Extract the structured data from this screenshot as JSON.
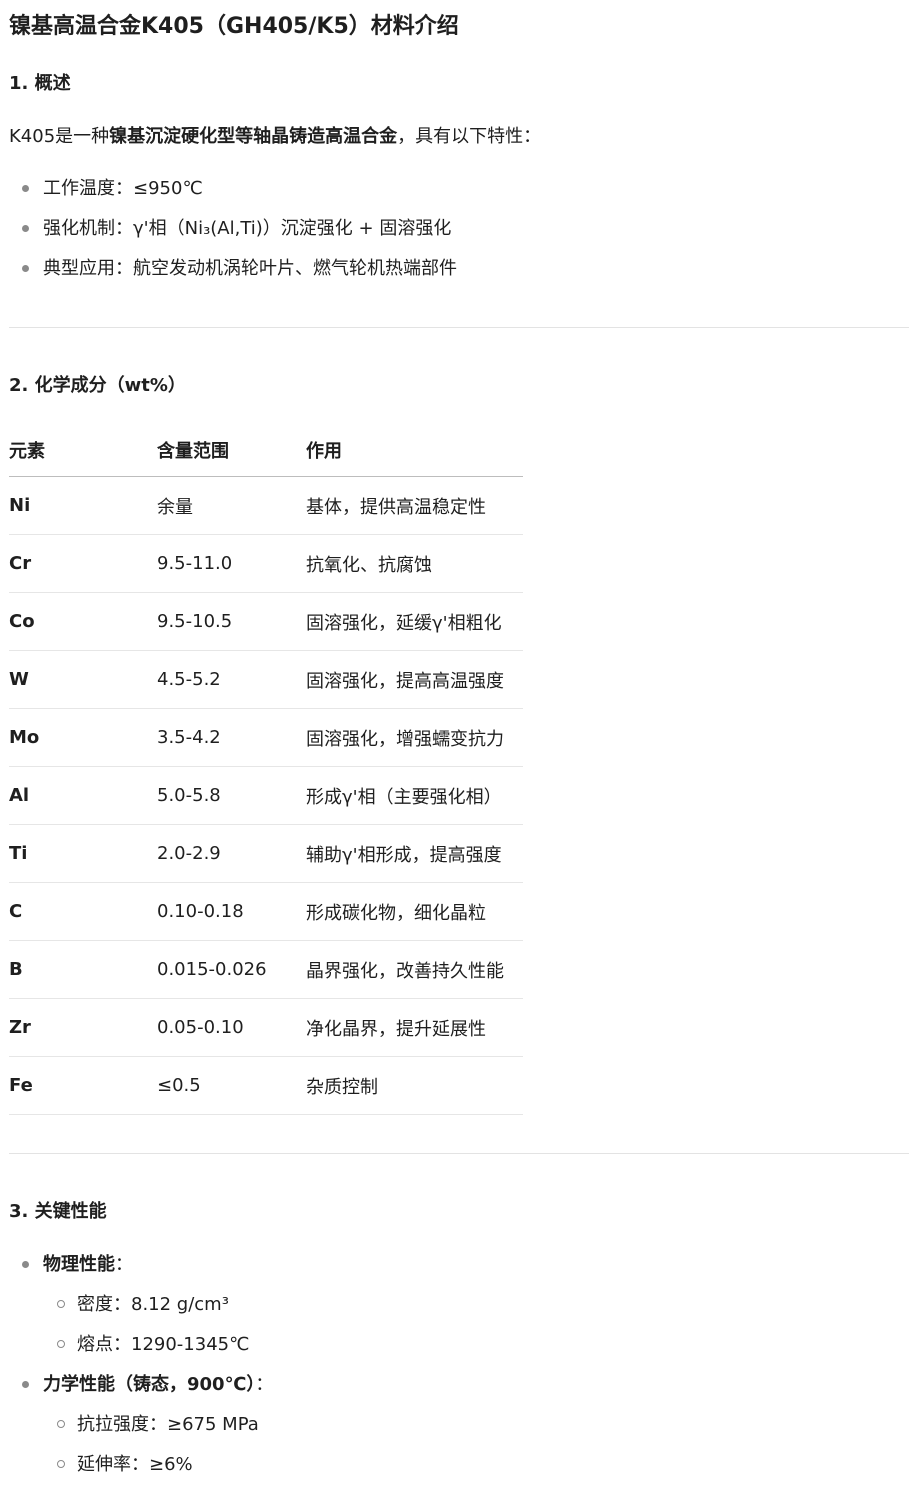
{
  "title": "镍基高温合金K405（GH405/K5）材料介绍",
  "section1": {
    "heading": "1. 概述",
    "intro_prefix": "K405是一种",
    "intro_bold": "镍基沉淀硬化型等轴晶铸造高温合金",
    "intro_suffix": "，具有以下特性：",
    "bullets": [
      "工作温度：≤950℃",
      "强化机制：γ'相（Ni₃(Al,Ti)）沉淀强化 + 固溶强化",
      "典型应用：航空发动机涡轮叶片、燃气轮机热端部件"
    ]
  },
  "section2": {
    "heading": "2. 化学成分（wt%）",
    "columns": [
      "元素",
      "含量范围",
      "作用"
    ],
    "rows": [
      [
        "Ni",
        "余量",
        "基体，提供高温稳定性"
      ],
      [
        "Cr",
        "9.5-11.0",
        "抗氧化、抗腐蚀"
      ],
      [
        "Co",
        "9.5-10.5",
        "固溶强化，延缓γ'相粗化"
      ],
      [
        "W",
        "4.5-5.2",
        "固溶强化，提高高温强度"
      ],
      [
        "Mo",
        "3.5-4.2",
        "固溶强化，增强蠕变抗力"
      ],
      [
        "Al",
        "5.0-5.8",
        "形成γ'相（主要强化相）"
      ],
      [
        "Ti",
        "2.0-2.9",
        "辅助γ'相形成，提高强度"
      ],
      [
        "C",
        "0.10-0.18",
        "形成碳化物，细化晶粒"
      ],
      [
        "B",
        "0.015-0.026",
        "晶界强化，改善持久性能"
      ],
      [
        "Zr",
        "0.05-0.10",
        "净化晶界，提升延展性"
      ],
      [
        "Fe",
        "≤0.5",
        "杂质控制"
      ]
    ]
  },
  "section3": {
    "heading": "3. 关键性能",
    "groups": [
      {
        "label": "物理性能",
        "suffix": "：",
        "items": [
          "密度：8.12 g/cm³",
          "熔点：1290-1345℃"
        ]
      },
      {
        "label": "力学性能（铸态，900℃）",
        "suffix": "：",
        "items": [
          "抗拉强度：≥675 MPa",
          "延伸率：≥6%"
        ]
      }
    ]
  },
  "colors": {
    "text": "#1f1f1f",
    "bullet": "#8a8a8a",
    "divider": "#e3e3e3",
    "header_rule": "#bdbdbd"
  }
}
